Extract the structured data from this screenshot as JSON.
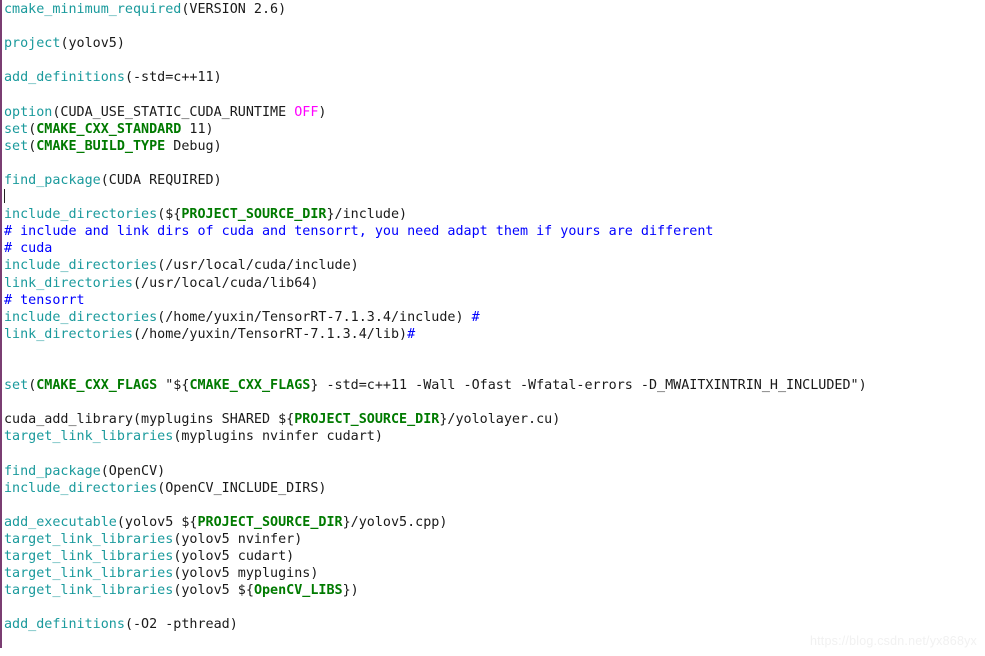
{
  "editor": {
    "language": "cmake",
    "filename_kind": "CMakeLists.txt",
    "colors": {
      "background": "#ffffff",
      "gutter_border": "#7a3d72",
      "command": "#1a9a9c",
      "variable": "#007a00",
      "comment": "#0000ff",
      "keyword": "#ff00ff",
      "plain_text": "#1a1a1a",
      "caret": "#222222",
      "watermark": "#f1f1f1"
    },
    "caret_line": 9
  },
  "watermark": {
    "text": "https://blog.csdn.net/yx868yx"
  },
  "lines": [
    {
      "n": 1,
      "tokens": [
        {
          "t": "cmd",
          "v": "cmake_minimum_required"
        },
        {
          "t": "plain",
          "v": "(VERSION 2.6)"
        }
      ]
    },
    {
      "n": 2,
      "tokens": []
    },
    {
      "n": 3,
      "tokens": [
        {
          "t": "cmd",
          "v": "project"
        },
        {
          "t": "plain",
          "v": "(yolov5)"
        }
      ]
    },
    {
      "n": 4,
      "tokens": []
    },
    {
      "n": 5,
      "tokens": [
        {
          "t": "cmd",
          "v": "add_definitions"
        },
        {
          "t": "plain",
          "v": "(-std=c++11)"
        }
      ]
    },
    {
      "n": 6,
      "tokens": []
    },
    {
      "n": 7,
      "tokens": [
        {
          "t": "cmd",
          "v": "option"
        },
        {
          "t": "plain",
          "v": "(CUDA_USE_STATIC_CUDA_RUNTIME "
        },
        {
          "t": "kw",
          "v": "OFF"
        },
        {
          "t": "plain",
          "v": ")"
        }
      ]
    },
    {
      "n": 8,
      "tokens": [
        {
          "t": "cmd",
          "v": "set"
        },
        {
          "t": "plain",
          "v": "("
        },
        {
          "t": "var",
          "v": "CMAKE_CXX_STANDARD"
        },
        {
          "t": "plain",
          "v": " 11)"
        }
      ]
    },
    {
      "n": 9,
      "tokens": [
        {
          "t": "cmd",
          "v": "set"
        },
        {
          "t": "plain",
          "v": "("
        },
        {
          "t": "var",
          "v": "CMAKE_BUILD_TYPE"
        },
        {
          "t": "plain",
          "v": " Debug)"
        }
      ]
    },
    {
      "n": 10,
      "tokens": []
    },
    {
      "n": 11,
      "tokens": [
        {
          "t": "cmd",
          "v": "find_package"
        },
        {
          "t": "plain",
          "v": "(CUDA REQUIRED)"
        }
      ]
    },
    {
      "n": 12,
      "tokens": [],
      "caret": true
    },
    {
      "n": 13,
      "tokens": [
        {
          "t": "cmd",
          "v": "include_directories"
        },
        {
          "t": "plain",
          "v": "(${"
        },
        {
          "t": "var",
          "v": "PROJECT_SOURCE_DIR"
        },
        {
          "t": "plain",
          "v": "}/include)"
        }
      ]
    },
    {
      "n": 14,
      "tokens": [
        {
          "t": "cmt",
          "v": "# include and link dirs of cuda and tensorrt, you need adapt them if yours are different"
        }
      ]
    },
    {
      "n": 15,
      "tokens": [
        {
          "t": "cmt",
          "v": "# cuda"
        }
      ]
    },
    {
      "n": 16,
      "tokens": [
        {
          "t": "cmd",
          "v": "include_directories"
        },
        {
          "t": "plain",
          "v": "(/usr/local/cuda/include)"
        }
      ]
    },
    {
      "n": 17,
      "tokens": [
        {
          "t": "cmd",
          "v": "link_directories"
        },
        {
          "t": "plain",
          "v": "(/usr/local/cuda/lib64)"
        }
      ]
    },
    {
      "n": 18,
      "tokens": [
        {
          "t": "cmt",
          "v": "# tensorrt"
        }
      ]
    },
    {
      "n": 19,
      "tokens": [
        {
          "t": "cmd",
          "v": "include_directories"
        },
        {
          "t": "plain",
          "v": "(/home/yuxin/TensorRT-7.1.3.4/include) "
        },
        {
          "t": "cmt",
          "v": "#"
        }
      ]
    },
    {
      "n": 20,
      "tokens": [
        {
          "t": "cmd",
          "v": "link_directories"
        },
        {
          "t": "plain",
          "v": "(/home/yuxin/TensorRT-7.1.3.4/lib)"
        },
        {
          "t": "cmt",
          "v": "#"
        }
      ]
    },
    {
      "n": 21,
      "tokens": []
    },
    {
      "n": 22,
      "tokens": []
    },
    {
      "n": 23,
      "tokens": [
        {
          "t": "cmd",
          "v": "set"
        },
        {
          "t": "plain",
          "v": "("
        },
        {
          "t": "var",
          "v": "CMAKE_CXX_FLAGS"
        },
        {
          "t": "plain",
          "v": " \"${"
        },
        {
          "t": "var",
          "v": "CMAKE_CXX_FLAGS"
        },
        {
          "t": "plain",
          "v": "} -std=c++11 -Wall -Ofast -Wfatal-errors -D_MWAITXINTRIN_H_INCLUDED\")"
        }
      ]
    },
    {
      "n": 24,
      "tokens": []
    },
    {
      "n": 25,
      "tokens": [
        {
          "t": "plain",
          "v": "cuda_add_library(myplugins SHARED ${"
        },
        {
          "t": "var",
          "v": "PROJECT_SOURCE_DIR"
        },
        {
          "t": "plain",
          "v": "}/yololayer.cu)"
        }
      ]
    },
    {
      "n": 26,
      "tokens": [
        {
          "t": "cmd",
          "v": "target_link_libraries"
        },
        {
          "t": "plain",
          "v": "(myplugins nvinfer cudart)"
        }
      ]
    },
    {
      "n": 27,
      "tokens": []
    },
    {
      "n": 28,
      "tokens": [
        {
          "t": "cmd",
          "v": "find_package"
        },
        {
          "t": "plain",
          "v": "(OpenCV)"
        }
      ]
    },
    {
      "n": 29,
      "tokens": [
        {
          "t": "cmd",
          "v": "include_directories"
        },
        {
          "t": "plain",
          "v": "(OpenCV_INCLUDE_DIRS)"
        }
      ]
    },
    {
      "n": 30,
      "tokens": []
    },
    {
      "n": 31,
      "tokens": [
        {
          "t": "cmd",
          "v": "add_executable"
        },
        {
          "t": "plain",
          "v": "(yolov5 ${"
        },
        {
          "t": "var",
          "v": "PROJECT_SOURCE_DIR"
        },
        {
          "t": "plain",
          "v": "}/yolov5.cpp)"
        }
      ]
    },
    {
      "n": 32,
      "tokens": [
        {
          "t": "cmd",
          "v": "target_link_libraries"
        },
        {
          "t": "plain",
          "v": "(yolov5 nvinfer)"
        }
      ]
    },
    {
      "n": 33,
      "tokens": [
        {
          "t": "cmd",
          "v": "target_link_libraries"
        },
        {
          "t": "plain",
          "v": "(yolov5 cudart)"
        }
      ]
    },
    {
      "n": 34,
      "tokens": [
        {
          "t": "cmd",
          "v": "target_link_libraries"
        },
        {
          "t": "plain",
          "v": "(yolov5 myplugins)"
        }
      ]
    },
    {
      "n": 35,
      "tokens": [
        {
          "t": "cmd",
          "v": "target_link_libraries"
        },
        {
          "t": "plain",
          "v": "(yolov5 ${"
        },
        {
          "t": "var",
          "v": "OpenCV_LIBS"
        },
        {
          "t": "plain",
          "v": "})"
        }
      ]
    },
    {
      "n": 36,
      "tokens": []
    },
    {
      "n": 37,
      "tokens": [
        {
          "t": "cmd",
          "v": "add_definitions"
        },
        {
          "t": "plain",
          "v": "(-O2 -pthread)"
        }
      ]
    }
  ]
}
